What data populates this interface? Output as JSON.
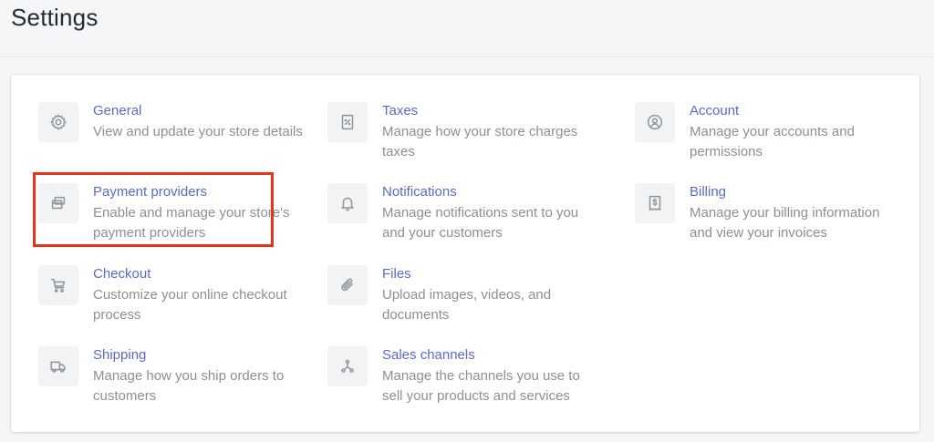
{
  "page": {
    "title": "Settings"
  },
  "items": [
    {
      "key": "general",
      "title": "General",
      "description": "View and update your store details",
      "icon": "gear-icon"
    },
    {
      "key": "taxes",
      "title": "Taxes",
      "description": "Manage how your store charges taxes",
      "icon": "receipt-percent-icon"
    },
    {
      "key": "account",
      "title": "Account",
      "description": "Manage your accounts and permissions",
      "icon": "user-circle-icon"
    },
    {
      "key": "payment-providers",
      "title": "Payment providers",
      "description": "Enable and manage your store's payment providers",
      "icon": "credit-cards-icon"
    },
    {
      "key": "notifications",
      "title": "Notifications",
      "description": "Manage notifications sent to you and your customers",
      "icon": "bell-icon"
    },
    {
      "key": "billing",
      "title": "Billing",
      "description": "Manage your billing information and view your invoices",
      "icon": "invoice-dollar-icon"
    },
    {
      "key": "checkout",
      "title": "Checkout",
      "description": "Customize your online checkout process",
      "icon": "cart-icon"
    },
    {
      "key": "files",
      "title": "Files",
      "description": "Upload images, videos, and documents",
      "icon": "paperclip-icon"
    },
    {
      "key": "shipping",
      "title": "Shipping",
      "description": "Manage how you ship orders to customers",
      "icon": "truck-icon"
    },
    {
      "key": "sales-channels",
      "title": "Sales channels",
      "description": "Manage the channels you use to sell your products and services",
      "icon": "channels-icon"
    }
  ],
  "colors": {
    "link": "#5c6ac4",
    "muted_text": "#8a9099",
    "highlight_border": "#e8331c",
    "background": "#f4f6f8"
  }
}
